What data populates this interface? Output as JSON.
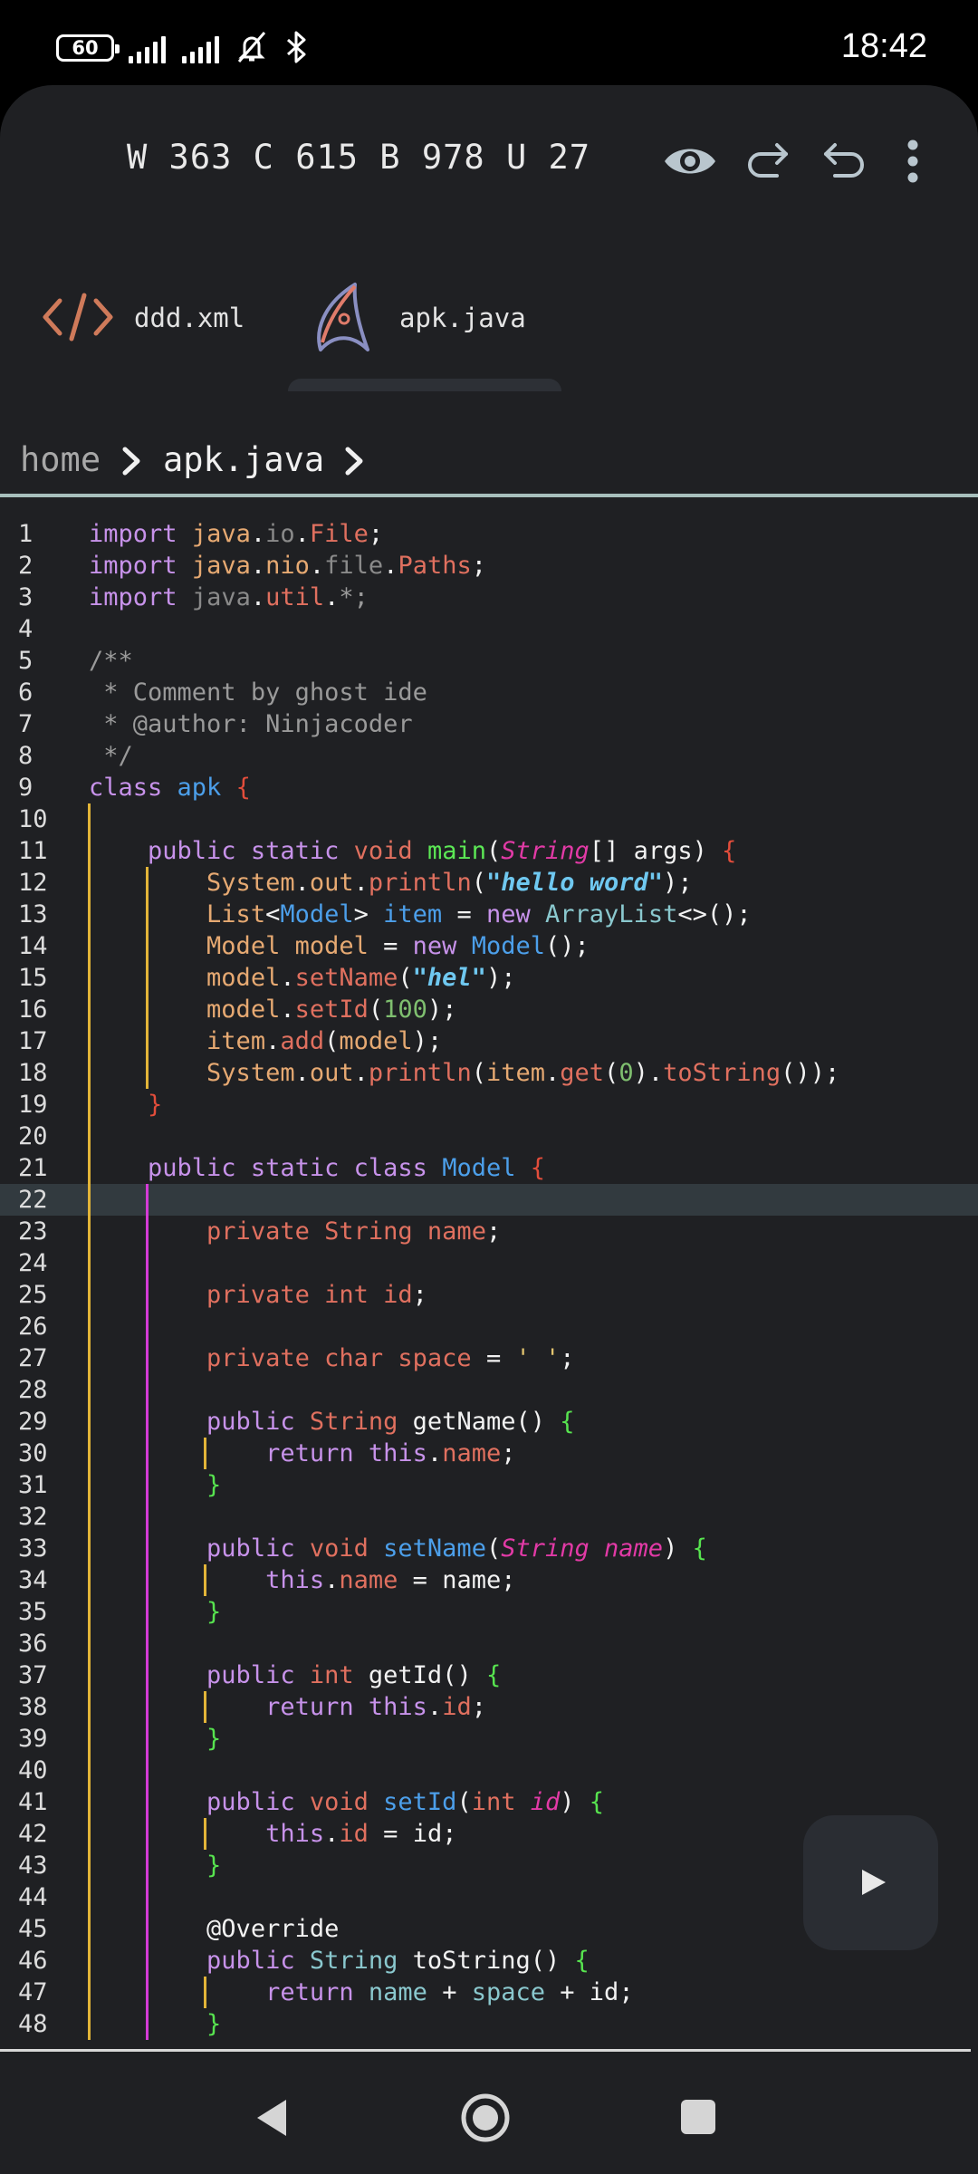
{
  "status_bar": {
    "battery": "60",
    "time": "18:42"
  },
  "toolbar": {
    "counts": "W 363 C 615 B 978 U 27"
  },
  "tabs": [
    {
      "label": "ddd.xml"
    },
    {
      "label": "apk.java"
    }
  ],
  "breadcrumb": {
    "home": "home",
    "file": "apk.java"
  },
  "editor": {
    "current_line": 22,
    "lines": [
      "import java.io.File;",
      "import java.nio.file.Paths;",
      "import java.util.*;",
      "",
      "/**",
      " * Comment by ghost ide",
      " * @author: Ninjacoder",
      " */",
      "class apk {",
      "",
      "    public static void main(String[] args) {",
      "        System.out.println(\"hello word\");",
      "        List<Model> item = new ArrayList<>();",
      "        Model model = new Model();",
      "        model.setName(\"hel\");",
      "        model.setId(100);",
      "        item.add(model);",
      "        System.out.println(item.get(0).toString());",
      "    }",
      "",
      "    public static class Model {",
      "",
      "        private String name;",
      "",
      "        private int id;",
      "",
      "        private char space = ' ';",
      "",
      "        public String getName() {",
      "            return this.name;",
      "        }",
      "",
      "        public void setName(String name) {",
      "            this.name = name;",
      "        }",
      "",
      "        public int getId() {",
      "            return this.id;",
      "        }",
      "",
      "        public void setId(int id) {",
      "            this.id = id;",
      "        }",
      "",
      "        @Override",
      "        public String toString() {",
      "            return name + space + id;",
      "        }"
    ]
  }
}
